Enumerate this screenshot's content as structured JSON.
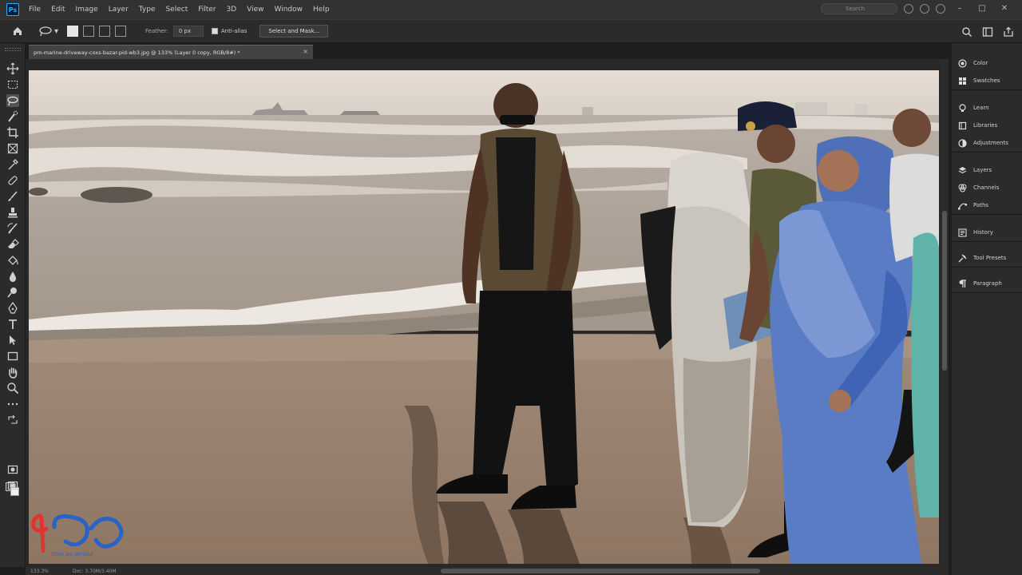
{
  "app": {
    "icon": "photoshop-logo"
  },
  "menu": {
    "items": [
      "File",
      "Edit",
      "Image",
      "Layer",
      "Type",
      "Select",
      "Filter",
      "3D",
      "View",
      "Window",
      "Help"
    ]
  },
  "menu_right": {
    "search_placeholder": "Search"
  },
  "options": {
    "feather_label": "Feather:",
    "feather_value": "0 px",
    "antialias_label": "Anti-alias",
    "select_mask_label": "Select and Mask..."
  },
  "document": {
    "tab_title": "pm-marine-driveway-coxs-bazar-pid-wb3.jpg @ 133% (Layer 0 copy, RGB/8#) *",
    "close_glyph": "×"
  },
  "status": {
    "zoom": "133.3%",
    "doc_size": "Doc: 3.70M/3.40M"
  },
  "panels": {
    "group1": [
      {
        "label": "Color",
        "icon": "color-icon"
      },
      {
        "label": "Swatches",
        "icon": "swatches-icon"
      }
    ],
    "group2": [
      {
        "label": "Learn",
        "icon": "learn-icon"
      },
      {
        "label": "Libraries",
        "icon": "libraries-icon"
      },
      {
        "label": "Adjustments",
        "icon": "adjustments-icon"
      }
    ],
    "group3": [
      {
        "label": "Layers",
        "icon": "layers-icon"
      },
      {
        "label": "Channels",
        "icon": "channels-icon"
      },
      {
        "label": "Paths",
        "icon": "paths-icon"
      }
    ],
    "group4": [
      {
        "label": "History",
        "icon": "history-icon"
      }
    ],
    "group5": [
      {
        "label": "Tool Presets",
        "icon": "tool-presets-icon"
      }
    ],
    "group6": [
      {
        "label": "Paragraph",
        "icon": "paragraph-icon"
      }
    ]
  },
  "watermark": {
    "text": "Shot by Jahidul"
  },
  "colors": {
    "ui_dark": "#2b2b2b",
    "menu": "#323232",
    "accent_blue": "#31a8ff",
    "logo_red": "#e0342f",
    "logo_blue": "#2a63c6"
  }
}
